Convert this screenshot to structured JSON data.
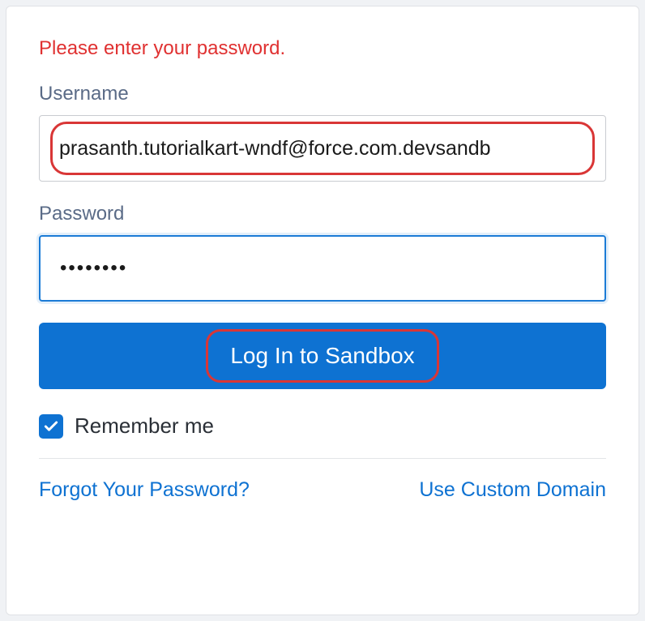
{
  "error_message": "Please enter your password.",
  "username": {
    "label": "Username",
    "value": "prasanth.tutorialkart-wndf@force.com.devsandb"
  },
  "password": {
    "label": "Password",
    "value": "••••••••"
  },
  "login_button_label": "Log In to Sandbox",
  "remember_me_label": "Remember me",
  "remember_me_checked": true,
  "links": {
    "forgot_password": "Forgot Your Password?",
    "custom_domain": "Use Custom Domain"
  }
}
